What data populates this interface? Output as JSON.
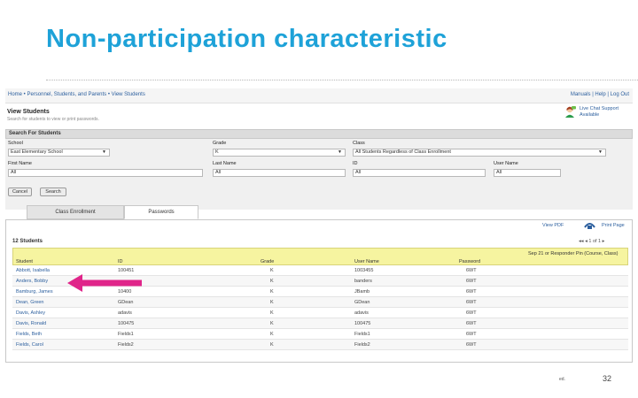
{
  "slide": {
    "title": "Non-participation characteristic",
    "page_number": "32",
    "logo_text": "ed."
  },
  "app": {
    "breadcrumb": "Home • Personnel, Students, and Parents • View Students",
    "top_links": "Manuals | Help | Log Out",
    "page_title": "View Students",
    "page_subtitle": "Search for students to view or print passwords.",
    "chat_text": "Live Chat Support Available",
    "search_header": "Search For Students",
    "filters": {
      "school_label": "School",
      "school_value": "East Elementary School",
      "grade_label": "Grade",
      "grade_value": "K",
      "class_label": "Class",
      "class_value": "All Students Regardless of Class Enrollment",
      "first_name_label": "First Name",
      "first_name_value": "All",
      "last_name_label": "Last Name",
      "last_name_value": "All",
      "id_label": "ID",
      "id_value": "All",
      "user_name_label": "User Name",
      "user_name_value": "All"
    },
    "buttons": {
      "cancel": "Cancel",
      "search": "Search"
    },
    "tabs": [
      "Class Enrollment",
      "Passwords"
    ],
    "view_pdf": "View PDF",
    "print_page": "Print Page",
    "student_count": "12 Students",
    "pager": "1 of 1",
    "columns": [
      "Student",
      "ID",
      "Grade",
      "User Name",
      "Password",
      "Sep 21 or Responder Pin (Course, Class)"
    ],
    "rows": [
      {
        "student": "Abbott, Isabella",
        "id": "100451",
        "grade": "K",
        "user": "1003455",
        "password": "6WT"
      },
      {
        "student": "Anders, Bobby",
        "id": "",
        "grade": "K",
        "user": "banders",
        "password": "6WT"
      },
      {
        "student": "Bamburg, James",
        "id": "10400",
        "grade": "K",
        "user": "JBamb",
        "password": "6WT"
      },
      {
        "student": "Dean, Green",
        "id": "GDean",
        "grade": "K",
        "user": "GDean",
        "password": "6WT"
      },
      {
        "student": "Davis, Ashley",
        "id": "adavis",
        "grade": "K",
        "user": "adavis",
        "password": "6WT"
      },
      {
        "student": "Davis, Ronald",
        "id": "100475",
        "grade": "K",
        "user": "100475",
        "password": "6WT"
      },
      {
        "student": "Fields, Beth",
        "id": "Fields1",
        "grade": "K",
        "user": "Fields1",
        "password": "6WT"
      },
      {
        "student": "Fields, Carol",
        "id": "Fields2",
        "grade": "K",
        "user": "Fields2",
        "password": "6WT"
      }
    ]
  },
  "colors": {
    "title": "#1ea2d8",
    "header_row": "#f6f4a0",
    "arrow": "#e0258a",
    "link": "#2c5f9e"
  }
}
